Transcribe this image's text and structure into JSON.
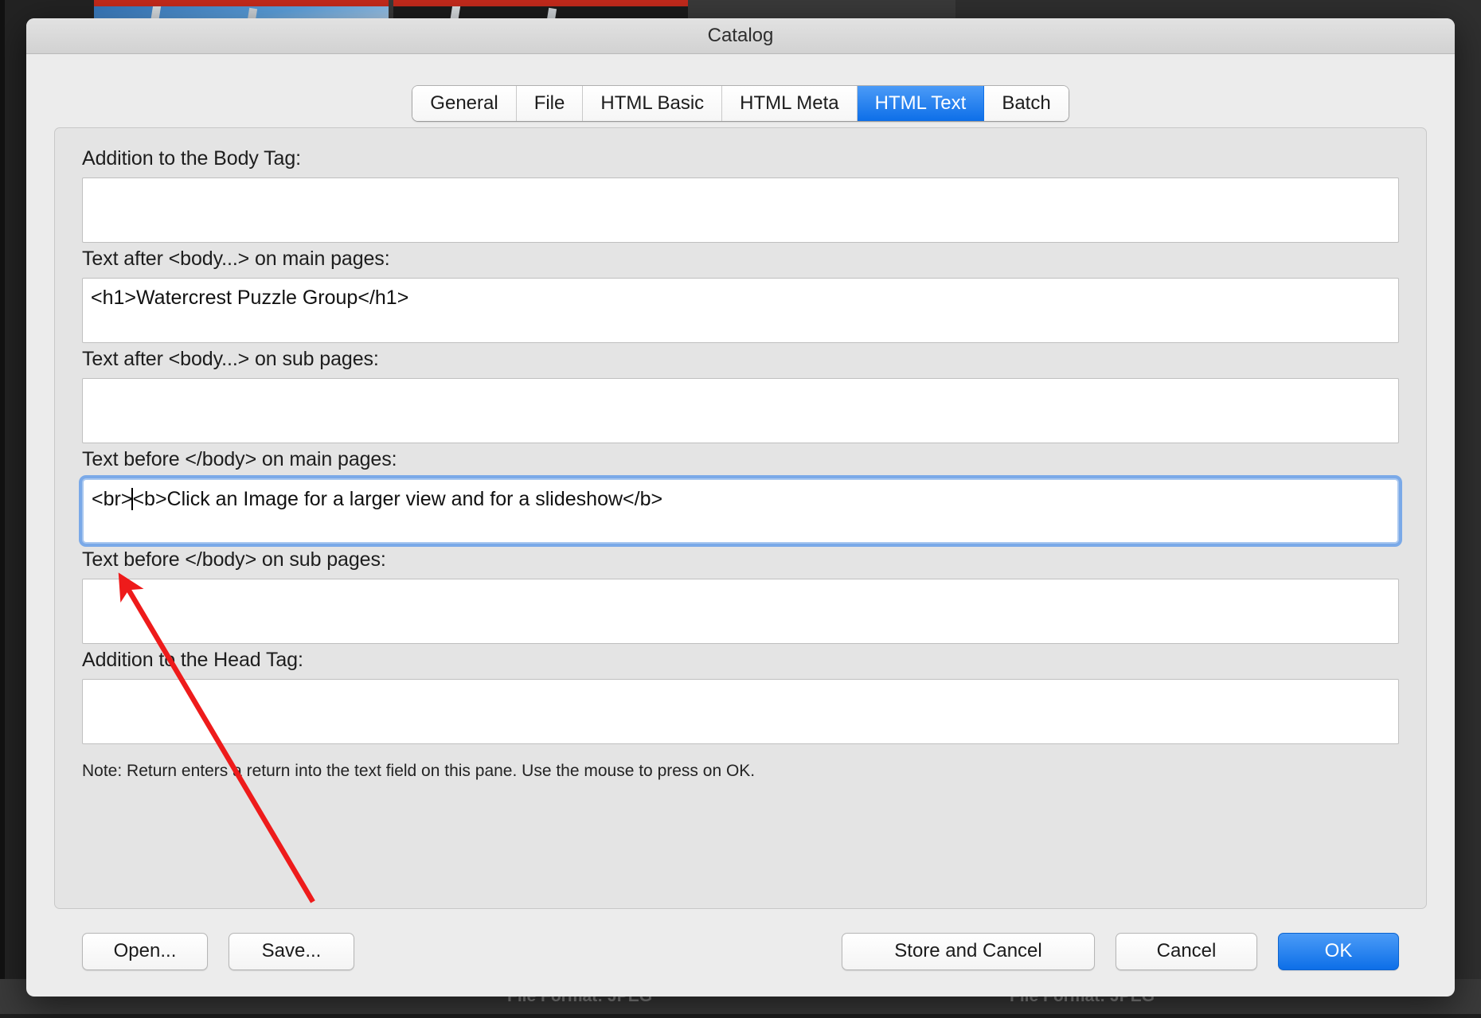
{
  "window": {
    "title": "Catalog"
  },
  "tabs": [
    {
      "label": "General",
      "active": false
    },
    {
      "label": "File",
      "active": false
    },
    {
      "label": "HTML Basic",
      "active": false
    },
    {
      "label": "HTML Meta",
      "active": false
    },
    {
      "label": "HTML Text",
      "active": true
    },
    {
      "label": "Batch",
      "active": false
    }
  ],
  "fields": {
    "body_tag_addition": {
      "label": "Addition to the Body Tag:",
      "value": "",
      "focused": false
    },
    "after_body_main": {
      "label": "Text after <body...> on main pages:",
      "value": "<h1>Watercrest Puzzle Group</h1>",
      "focused": false
    },
    "after_body_sub": {
      "label": "Text after <body...> on sub pages:",
      "value": "",
      "focused": false
    },
    "before_body_main": {
      "label": "Text before </body> on main pages:",
      "value_before_caret": "<br>",
      "value_after_caret": "<b>Click an Image for a larger view and for a slideshow</b>",
      "value": "<br><b>Click an Image for a larger view and for a slideshow</b>",
      "focused": true
    },
    "before_body_sub": {
      "label": "Text before </body> on sub pages:",
      "value": "",
      "focused": false
    },
    "head_tag_addition": {
      "label": "Addition to the Head Tag:",
      "value": "",
      "focused": false
    }
  },
  "note": "Note: Return enters a return into the text field on this pane. Use the mouse to press on OK.",
  "footer": {
    "open_label": "Open...",
    "save_label": "Save...",
    "store_and_cancel_label": "Store and Cancel",
    "cancel_label": "Cancel",
    "ok_label": "OK"
  },
  "background": {
    "footer_left_text": "File Format:  JPEG",
    "footer_right_text": "File Format:  JPEG"
  },
  "colors": {
    "accent_blue": "#0d6fe8",
    "focus_ring": "#7aa9e8",
    "annotation_red": "#ee1b1b",
    "window_bg": "#ececec",
    "panel_bg": "#e4e4e4"
  }
}
